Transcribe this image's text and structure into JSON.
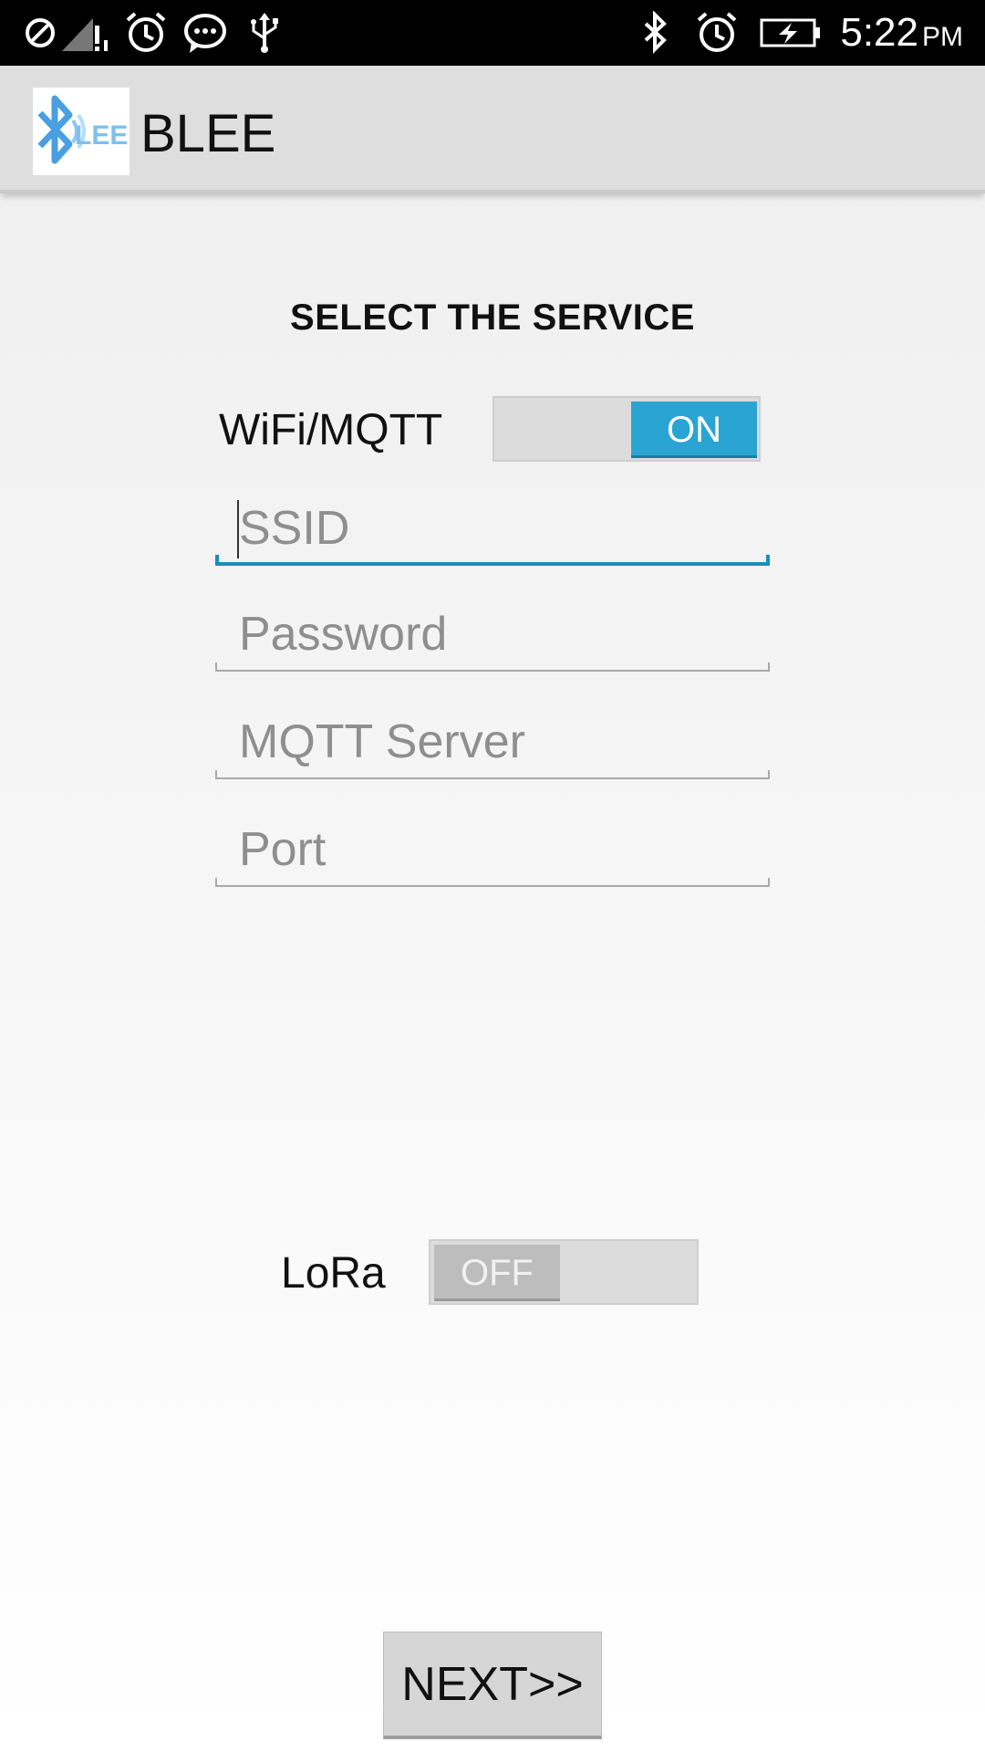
{
  "status_bar": {
    "time": "5:22",
    "ampm": "PM",
    "left_icons": [
      "blocked-icon",
      "signal-alert-icon",
      "alarm-icon",
      "chat-icon",
      "usb-icon"
    ],
    "right_icons": [
      "bluetooth-icon",
      "alarm-icon",
      "battery-charging-icon"
    ]
  },
  "action_bar": {
    "title": "BLEE",
    "logo_text": "LEE"
  },
  "main": {
    "heading": "SELECT THE SERVICE",
    "wifi": {
      "label": "WiFi/MQTT",
      "toggle_text": "ON",
      "state": "on"
    },
    "fields": {
      "ssid_placeholder": "SSID",
      "password_placeholder": "Password",
      "mqtt_server_placeholder": "MQTT Server",
      "port_placeholder": "Port"
    },
    "lora": {
      "label": "LoRa",
      "toggle_text": "OFF",
      "state": "off"
    },
    "next_label": "NEXT>>"
  },
  "colors": {
    "accent": "#2aa5d3",
    "active_underline": "#1b8dbd",
    "status_bar": "#000000",
    "action_bar": "#dedede"
  }
}
